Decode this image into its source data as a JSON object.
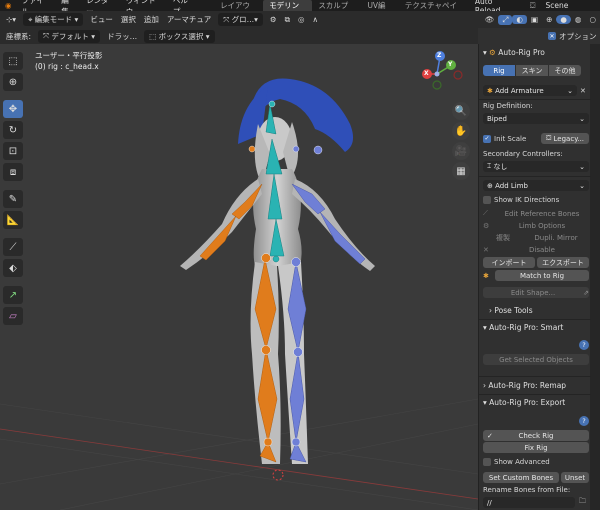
{
  "topbar": {
    "menus": [
      "ファイル",
      "編集",
      "レンダー",
      "ウィンドウ",
      "ヘルプ"
    ],
    "workspaces": [
      "レイアウト",
      "モデリング",
      "スカルプト",
      "UV編集",
      "テクスチャペイン"
    ],
    "active_workspace": "モデリング",
    "auto_reload": "Auto Reload",
    "scene": "Scene"
  },
  "toolbar1": {
    "mode": "編集モード",
    "menus": [
      "ビュー",
      "選択",
      "追加",
      "アーマチュア"
    ],
    "global": "グロ…"
  },
  "toolbar2": {
    "orientation_label": "座標系:",
    "orientation": "デフォルト",
    "drag_label": "ドラッ…",
    "select_mode": "ボックス選択"
  },
  "options_label": "オプション",
  "viewport": {
    "view_name": "ユーザー・平行投影",
    "active_object": "(0) rig : c_head.x"
  },
  "gizmo": {
    "z": "Z",
    "y": "Y",
    "x": "X"
  },
  "panel": {
    "title": "Auto-Rig Pro",
    "tabs": [
      "Rig",
      "スキン",
      "その他"
    ],
    "active_tab": "Rig",
    "add_armature": "Add Armature",
    "rig_definition_label": "Rig Definition:",
    "rig_definition": "Biped",
    "init_scale": "Init Scale",
    "legacy": "Legacy...",
    "secondary_label": "Secondary Controllers:",
    "secondary_value": "なし",
    "add_limb": "Add Limb",
    "show_ik": "Show IK Directions",
    "edit_ref": "Edit Reference Bones",
    "limb_options": "Limb Options",
    "dupli_label": "複製",
    "dupli_mirror": "Dupli. Mirror",
    "disable": "Disable",
    "import": "インポート",
    "export": "エクスポート",
    "match_to_rig": "Match to Rig",
    "edit_shape": "Edit Shape...",
    "pose_tools": "Pose Tools",
    "smart_title": "Auto-Rig Pro: Smart",
    "get_selected": "Get Selected Objects",
    "remap_title": "Auto-Rig Pro: Remap",
    "export_title": "Auto-Rig Pro: Export",
    "check_rig": "Check Rig",
    "fix_rig": "Fix Rig",
    "show_advanced": "Show Advanced",
    "set_custom_bones": "Set Custom Bones",
    "unset": "Unset",
    "rename_bones_label": "Rename Bones from File:",
    "rename_path": "//",
    "help": "?"
  },
  "colors": {
    "accent": "#4772b3",
    "left_bone": "#e07c1c",
    "right_bone": "#6f7fd6",
    "center_bone": "#2ab3b3"
  }
}
